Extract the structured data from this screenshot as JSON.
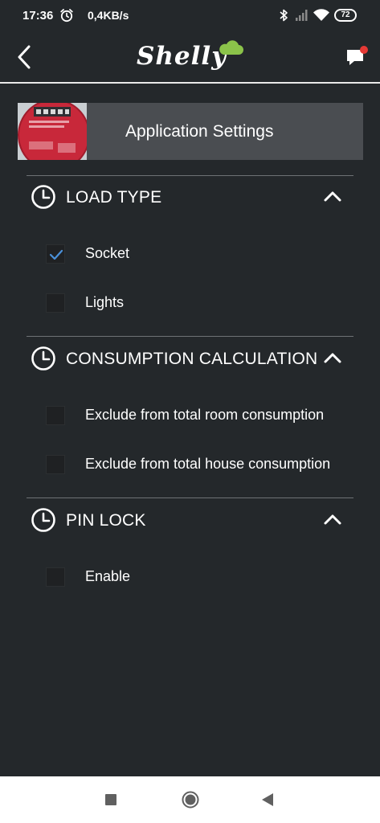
{
  "status_bar": {
    "time": "17:36",
    "network_speed": "0,4KB/s",
    "battery": "72"
  },
  "app_bar": {
    "logo_text": "Shelly",
    "icons": [
      "back-arrow-icon",
      "cloud-icon",
      "chat-notification-icon"
    ],
    "accent_colors": {
      "cloud": "#8bc34a",
      "notification_dot": "#e53935"
    }
  },
  "header": {
    "title": "Application Settings"
  },
  "sections": [
    {
      "title": "LOAD TYPE",
      "options": [
        {
          "label": "Socket",
          "checked": true
        },
        {
          "label": "Lights",
          "checked": false
        }
      ]
    },
    {
      "title": "CONSUMPTION CALCULATION",
      "options": [
        {
          "label": "Exclude from total room consumption",
          "checked": false
        },
        {
          "label": "Exclude from total house consumption",
          "checked": false
        }
      ]
    },
    {
      "title": "PIN LOCK",
      "options": [
        {
          "label": "Enable",
          "checked": false
        }
      ]
    }
  ],
  "colors": {
    "background": "#24282b",
    "header_card": "#4a4d51",
    "checkmark": "#4a90d9"
  },
  "nav_bar": {
    "icons": [
      "recent-apps-icon",
      "home-icon",
      "back-triangle-icon"
    ]
  }
}
